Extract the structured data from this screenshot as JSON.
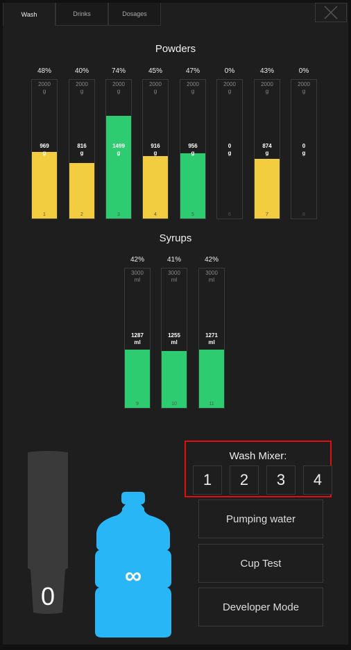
{
  "tabs": [
    {
      "label": "Wash",
      "active": true
    },
    {
      "label": "Drinks",
      "active": false
    },
    {
      "label": "Dosages",
      "active": false
    }
  ],
  "powders": {
    "title": "Powders",
    "containers": [
      {
        "index": "1",
        "percent": "48%",
        "capacity": "2000",
        "unit": "g",
        "amount": "969",
        "level": 0.48,
        "color": "#f1cd3f"
      },
      {
        "index": "2",
        "percent": "40%",
        "capacity": "2000",
        "unit": "g",
        "amount": "816",
        "level": 0.4,
        "color": "#f1cd3f"
      },
      {
        "index": "3",
        "percent": "74%",
        "capacity": "2000",
        "unit": "g",
        "amount": "1499",
        "level": 0.74,
        "color": "#2ecc71"
      },
      {
        "index": "4",
        "percent": "45%",
        "capacity": "2000",
        "unit": "g",
        "amount": "916",
        "level": 0.45,
        "color": "#f1cd3f"
      },
      {
        "index": "5",
        "percent": "47%",
        "capacity": "2000",
        "unit": "g",
        "amount": "956",
        "level": 0.47,
        "color": "#2ecc71"
      },
      {
        "index": "6",
        "percent": "0%",
        "capacity": "2000",
        "unit": "g",
        "amount": "0",
        "level": 0,
        "color": "#2ecc71"
      },
      {
        "index": "7",
        "percent": "43%",
        "capacity": "2000",
        "unit": "g",
        "amount": "874",
        "level": 0.43,
        "color": "#f1cd3f"
      },
      {
        "index": "8",
        "percent": "0%",
        "capacity": "2000",
        "unit": "g",
        "amount": "0",
        "level": 0,
        "color": "#2ecc71"
      }
    ]
  },
  "syrups": {
    "title": "Syrups",
    "containers": [
      {
        "index": "9",
        "percent": "42%",
        "capacity": "3000",
        "unit": "ml",
        "amount": "1287",
        "level": 0.42,
        "color": "#2ecc71"
      },
      {
        "index": "10",
        "percent": "41%",
        "capacity": "3000",
        "unit": "ml",
        "amount": "1255",
        "level": 0.41,
        "color": "#2ecc71"
      },
      {
        "index": "11",
        "percent": "42%",
        "capacity": "3000",
        "unit": "ml",
        "amount": "1271",
        "level": 0.42,
        "color": "#2ecc71"
      }
    ]
  },
  "cup": {
    "count": "0",
    "color": "#3a3a3a"
  },
  "bottle": {
    "label": "∞",
    "color": "#29b6f6"
  },
  "wash_mixer": {
    "title": "Wash Mixer:",
    "buttons": [
      "1",
      "2",
      "3",
      "4"
    ],
    "highlight_color": "#e01010"
  },
  "actions": {
    "pumping_water": "Pumping water",
    "cup_test": "Cup Test",
    "developer_mode": "Developer Mode"
  }
}
